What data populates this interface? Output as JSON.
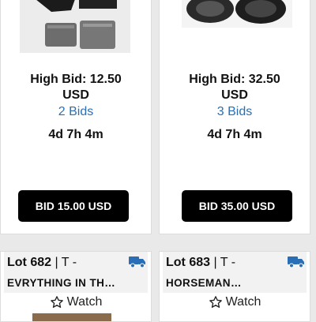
{
  "cards": [
    {
      "high_bid_line1": "High Bid: 12.50",
      "high_bid_line2": "USD",
      "bids": "2 Bids",
      "time_left": "4d 7h 4m",
      "bid_button": "BID 15.00 USD"
    },
    {
      "high_bid_line1": "High Bid: 32.50",
      "high_bid_line2": "USD",
      "bids": "3 Bids",
      "time_left": "4d 7h 4m",
      "bid_button": "BID 35.00 USD"
    }
  ],
  "lots": [
    {
      "lot_label": "Lot 682",
      "separator": " | T -",
      "title": "EVRYTHING IN TH…",
      "watch": "Watch"
    },
    {
      "lot_label": "Lot 683",
      "separator": " | T -",
      "title": "HORSEMAN…",
      "watch": "Watch"
    }
  ],
  "colors": {
    "link": "#2a6fb5",
    "truck_icon": "#2a6fb5",
    "button_bg": "#000000"
  },
  "icons": {
    "shipping": "truck-icon",
    "watch": "star-outline-icon"
  }
}
